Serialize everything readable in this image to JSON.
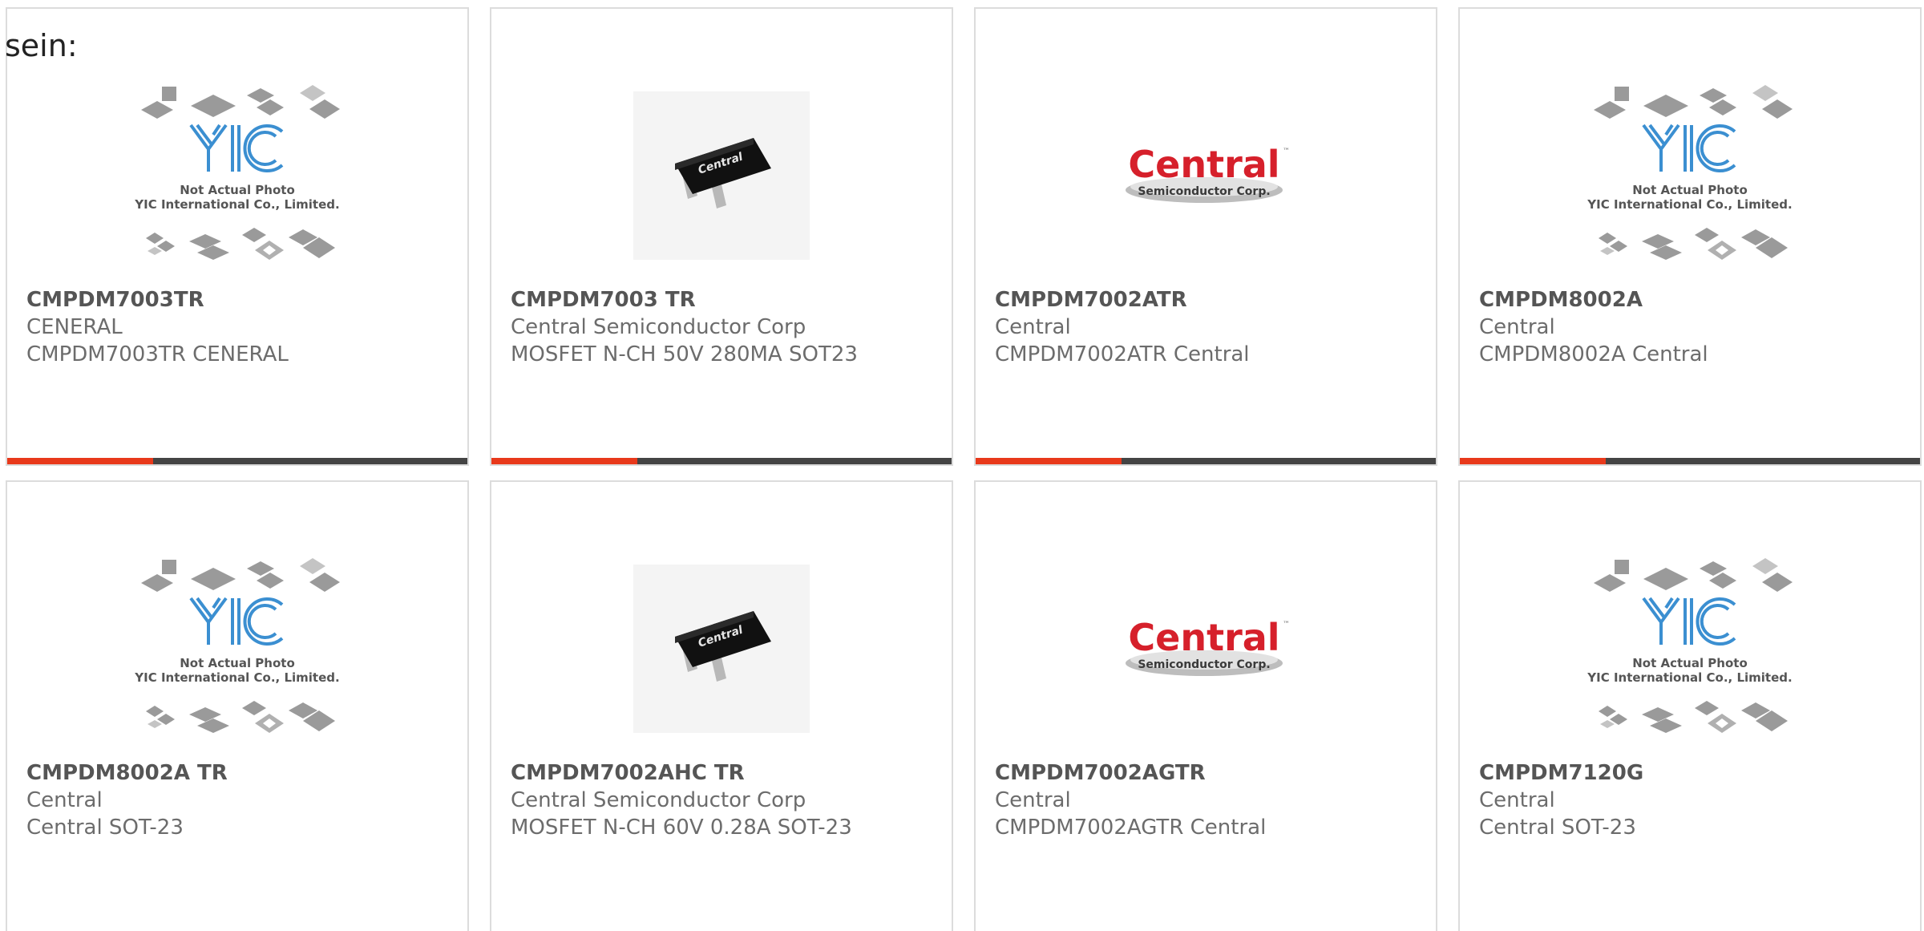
{
  "heading": "sein:",
  "colors": {
    "accent": "#e8391b",
    "bar": "#444444",
    "text": "#6c6c6c",
    "border": "#dcdcdc",
    "central_red": "#d6202b",
    "yic_blue": "#3b8fd1"
  },
  "products": [
    {
      "part": "CMPDM7003TR",
      "maker": "CENERAL",
      "desc": "CMPDM7003TR CENERAL",
      "image": "yic-placeholder",
      "image_text": [
        "Not Actual Photo",
        "YIC International Co., Limited."
      ]
    },
    {
      "part": "CMPDM7003 TR",
      "maker": "Central Semiconductor Corp",
      "desc": "MOSFET N-CH 50V 280MA SOT23",
      "image": "sot23-chip",
      "image_text": [
        "Central"
      ]
    },
    {
      "part": "CMPDM7002ATR",
      "maker": "Central",
      "desc": "CMPDM7002ATR Central",
      "image": "central-logo",
      "image_text": [
        "Central",
        "Semiconductor Corp."
      ]
    },
    {
      "part": "CMPDM8002A",
      "maker": "Central",
      "desc": "CMPDM8002A Central",
      "image": "yic-placeholder",
      "image_text": [
        "Not Actual Photo",
        "YIC International Co., Limited."
      ]
    },
    {
      "part": "CMPDM8002A TR",
      "maker": "Central",
      "desc": "Central SOT-23",
      "image": "yic-placeholder",
      "image_text": [
        "Not Actual Photo",
        "YIC International Co., Limited."
      ]
    },
    {
      "part": "CMPDM7002AHC TR",
      "maker": "Central Semiconductor Corp",
      "desc": "MOSFET N-CH 60V 0.28A SOT-23",
      "image": "sot23-chip",
      "image_text": [
        "Central"
      ]
    },
    {
      "part": "CMPDM7002AGTR",
      "maker": "Central",
      "desc": "CMPDM7002AGTR Central",
      "image": "central-logo",
      "image_text": [
        "Central",
        "Semiconductor Corp."
      ]
    },
    {
      "part": "CMPDM7120G",
      "maker": "Central",
      "desc": "Central SOT-23",
      "image": "yic-placeholder",
      "image_text": [
        "Not Actual Photo",
        "YIC International Co., Limited."
      ]
    }
  ]
}
